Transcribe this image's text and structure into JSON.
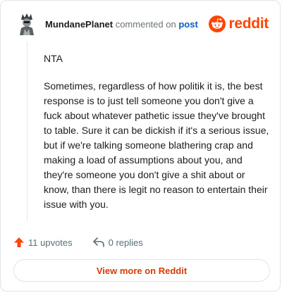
{
  "comment": {
    "username": "MundanePlanet",
    "verb": "commented on",
    "link": "post",
    "paragraphs": [
      "NTA",
      "Sometimes, regardless of how politik it is, the best response is to just tell someone you don't give a fuck about whatever pathetic issue they've brought to table. Sure it can be dickish if it's a serious issue, but if we're talking someone blathering crap and making a load of assumptions about you, and they're someone you don't give a shit about or know, than there is legit no reason to entertain their issue with you."
    ]
  },
  "brand": {
    "wordmark": "reddit",
    "color": "#ff4500"
  },
  "actions": {
    "upvotes": "11 upvotes",
    "replies": "0 replies"
  },
  "footer": {
    "view_more": "View more on Reddit"
  },
  "icons": {
    "avatar": "avatar-icon",
    "logo": "reddit-snoo-icon",
    "upvote": "upvote-arrow-icon",
    "reply": "reply-arrow-icon"
  }
}
